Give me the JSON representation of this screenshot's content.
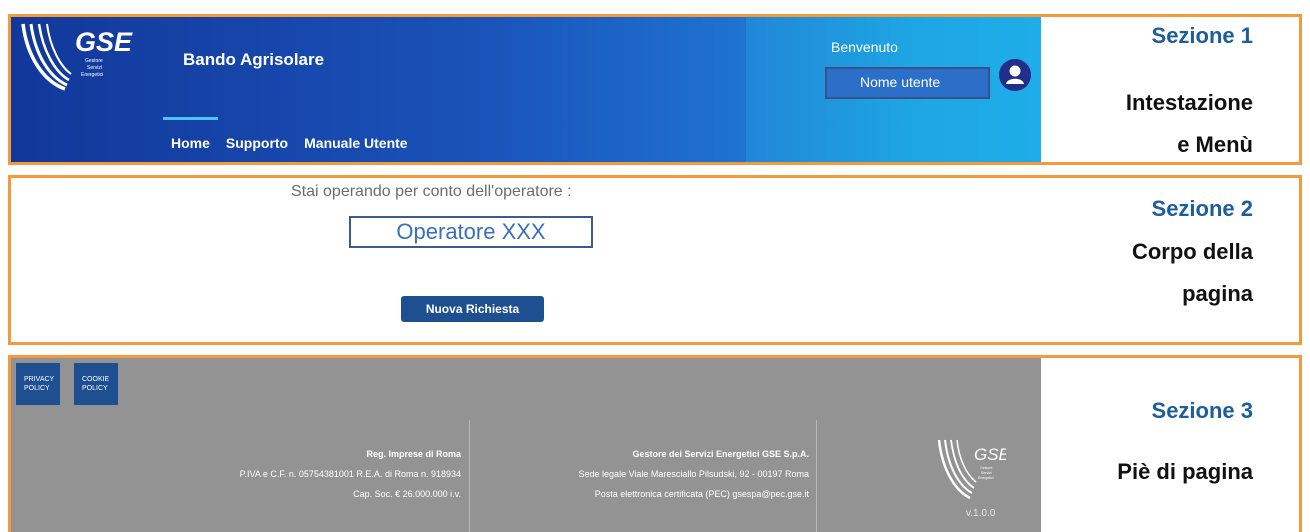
{
  "header": {
    "logo_text": "GSE",
    "logo_sub": [
      "Gestore",
      "Servizi",
      "Energetici"
    ],
    "app_title": "Bando Agrisolare",
    "nav": [
      {
        "label": "Home",
        "active": true
      },
      {
        "label": "Supporto",
        "active": false
      },
      {
        "label": "Manuale Utente",
        "active": false
      }
    ],
    "welcome": "Benvenuto",
    "username": "Nome utente",
    "avatar_icon": "user-icon"
  },
  "body": {
    "operating_text": "Stai operando per conto dell'operatore :",
    "operator_name": "Operatore XXX",
    "new_request_label": "Nuova Richiesta"
  },
  "footer": {
    "privacy_policy": [
      "PRIVACY",
      "POLICY"
    ],
    "cookie_policy": [
      "COOKIE",
      "POLICY"
    ],
    "col1": {
      "title": "Reg. Imprese di Roma",
      "line1": "P.IVA e C.F. n. 05754381001 R.E.A. di Roma n. 918934",
      "line2": "Cap. Soc. € 26.000.000 i.v."
    },
    "col2": {
      "title": "Gestore dei Servizi Energetici GSE S.p.A.",
      "line1": "Sede legale Viale Maresciallo Pilsudski, 92 - 00197 Roma",
      "line2": "Posta elettronica certificata (PEC) gsespa@pec.gse.it"
    },
    "version": "v.1.0.0"
  },
  "annotations": {
    "s1_label": "Sezione 1",
    "s1_desc": [
      "Intestazione",
      "e Menù"
    ],
    "s2_label": "Sezione 2",
    "s2_desc": [
      "Corpo della",
      "pagina"
    ],
    "s3_label": "Sezione 3",
    "s3_desc": "Piè di pagina"
  },
  "colors": {
    "frame": "#f3993e",
    "header_dark": "#12379a",
    "header_light": "#1ab0ea",
    "button_blue": "#1d4f91",
    "footer_gray": "#939393",
    "label_blue": "#1d5d9a"
  }
}
